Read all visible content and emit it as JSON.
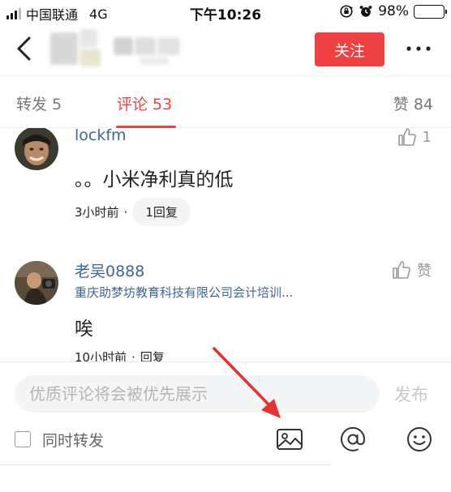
{
  "status_bar": {
    "carrier": "中国联通",
    "network": "4G",
    "time": "下午10:26",
    "battery": "98%",
    "battery_level": 0.98
  },
  "navbar": {
    "follow_label": "关注",
    "back_icon": "chevron-left-icon",
    "more_icon": "more-dots-icon"
  },
  "tabs": {
    "reposts": "转发 5",
    "comments": "评论 53",
    "likes": "赞 84",
    "active": "comments"
  },
  "comments": [
    {
      "name": "lockfm",
      "text": "。。小米净利真的低",
      "time": "3小时前",
      "dot": "·",
      "reply": "1回复",
      "likes": "1"
    },
    {
      "name": "老吴0888",
      "subtitle": "重庆助梦坊教育科技有限公司会计培训...",
      "text": "唉",
      "time": "10小时前",
      "dot": "·",
      "reply": "回复",
      "likes": "赞"
    }
  ],
  "input": {
    "placeholder": "优质评论将会被优先展示",
    "publish_label": "发布",
    "repost_label": "同时转发",
    "icons": [
      "image-icon",
      "at-icon",
      "emoji-icon"
    ]
  },
  "colors": {
    "accent": "#f04142",
    "link": "#406599",
    "annotation": "#e8312f"
  }
}
